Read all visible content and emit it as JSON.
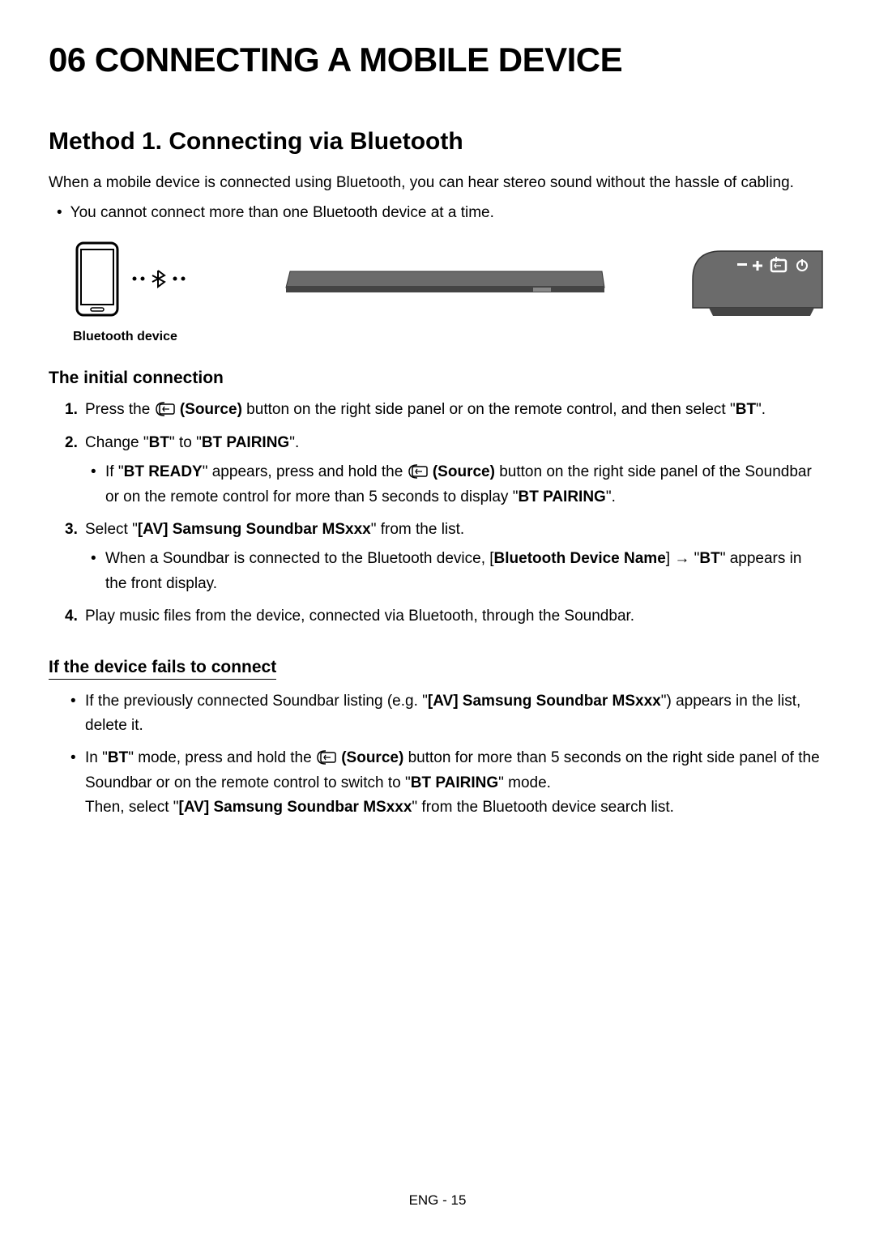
{
  "chapter": "06   CONNECTING A MOBILE DEVICE",
  "method_title": "Method 1. Connecting via Bluetooth",
  "intro": "When a mobile device is connected using Bluetooth, you can hear stereo sound without the hassle of cabling.",
  "top_bullet": "You cannot connect more than one Bluetooth device at a time.",
  "diagram_label": "Bluetooth device",
  "section_initial": "The initial connection",
  "steps": {
    "s1_num": "1.",
    "s1_pre": "Press the ",
    "s1_source": " (Source)",
    "s1_post": " button on the right side panel or on the remote control, and then select \"",
    "s1_bt": "BT",
    "s1_end": "\".",
    "s2_num": "2.",
    "s2_pre": "Change \"",
    "s2_bt": "BT",
    "s2_mid": "\" to \"",
    "s2_pairing": "BT PAIRING",
    "s2_end": "\".",
    "s2_sub_pre": "If \"",
    "s2_sub_ready": "BT READY",
    "s2_sub_mid1": "\" appears, press and hold the ",
    "s2_sub_source": " (Source)",
    "s2_sub_mid2": " button on the right side panel of the Soundbar or on the remote control for more than 5 seconds to display \"",
    "s2_sub_pairing": "BT PAIRING",
    "s2_sub_end": "\".",
    "s3_num": "3.",
    "s3_pre": "Select \"",
    "s3_av": "[AV] Samsung Soundbar MSxxx",
    "s3_post": "\" from the list.",
    "s3_sub_pre": "When a Soundbar is connected to the Bluetooth device, [",
    "s3_sub_bdn": "Bluetooth Device Name",
    "s3_sub_mid": "] → \"",
    "s3_sub_bt": "BT",
    "s3_sub_end": "\" appears in the front display.",
    "s4_num": "4.",
    "s4_text": "Play music files from the device, connected via Bluetooth, through the Soundbar."
  },
  "section_fails": "If the device fails to connect",
  "fails": {
    "f1_pre": "If the previously connected Soundbar listing (e.g. \"",
    "f1_av": "[AV] Samsung Soundbar MSxxx",
    "f1_post": "\") appears in the list, delete it.",
    "f2_pre": "In \"",
    "f2_bt": "BT",
    "f2_mid1": "\" mode, press and hold the ",
    "f2_source": " (Source)",
    "f2_mid2": " button for more than 5 seconds on the right side panel of the Soundbar or on the remote control to switch to \"",
    "f2_pairing": "BT PAIRING",
    "f2_mid3": "\" mode.",
    "f2_then_pre": "Then, select \"",
    "f2_then_av": "[AV] Samsung Soundbar MSxxx",
    "f2_then_post": "\" from the Bluetooth device search list."
  },
  "footer": "ENG - 15"
}
